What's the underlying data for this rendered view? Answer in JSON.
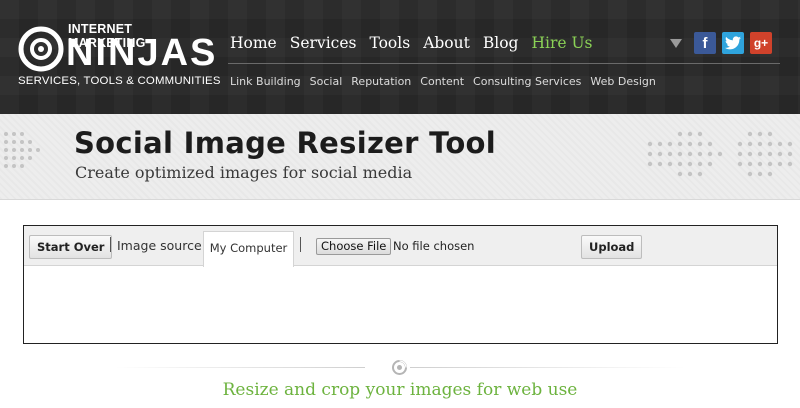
{
  "header": {
    "logo": {
      "top_text": "INTERNET MARKETING",
      "main_text": "NINJAS",
      "sub_text": "SERVICES, TOOLS & COMMUNITIES",
      "icon": "swirl-logo-icon"
    },
    "main_nav": [
      {
        "label": "Home"
      },
      {
        "label": "Services"
      },
      {
        "label": "Tools"
      },
      {
        "label": "About"
      },
      {
        "label": "Blog"
      },
      {
        "label": "Hire Us",
        "color": "#8bd256"
      }
    ],
    "social": {
      "dropdown_icon": "caret-down-icon",
      "facebook": {
        "glyph": "f",
        "icon": "facebook-icon",
        "color": "#3b5998"
      },
      "twitter": {
        "icon": "twitter-icon",
        "color": "#2fa4dd"
      },
      "googleplus": {
        "glyph": "g+",
        "icon": "google-plus-icon",
        "color": "#d0422b"
      }
    },
    "sub_nav": [
      {
        "label": "Link Building"
      },
      {
        "label": "Social"
      },
      {
        "label": "Reputation"
      },
      {
        "label": "Content"
      },
      {
        "label": "Consulting Services"
      },
      {
        "label": "Web Design"
      }
    ]
  },
  "banner": {
    "title": "Social Image Resizer Tool",
    "subtitle": "Create optimized images for social media"
  },
  "tool": {
    "start_over_label": "Start Over",
    "separator": "|",
    "image_source_label": "Image source:",
    "source_tab_label": "My Computer",
    "choose_file_label": "Choose File",
    "no_file_text": "No file chosen",
    "upload_label": "Upload"
  },
  "footer": {
    "divider_icon": "swirl-icon",
    "tagline": "Resize and crop your images for web use",
    "tagline_color": "#6db33f"
  }
}
